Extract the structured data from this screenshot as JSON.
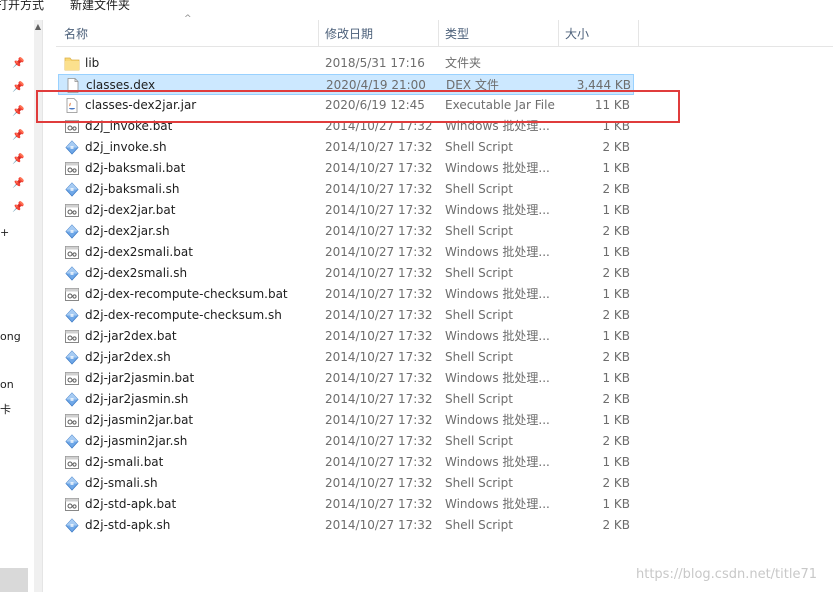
{
  "toolbar": {
    "open_with": "打开方式",
    "new_folder": "新建文件夹"
  },
  "left_pane": {
    "labels": [
      "+",
      "ong",
      "on",
      "卡"
    ]
  },
  "columns": {
    "name": "名称",
    "date": "修改日期",
    "type": "类型",
    "size": "大小"
  },
  "files": [
    {
      "name": "lib",
      "date": "2018/5/31 17:16",
      "type": "文件夹",
      "size": "",
      "icon": "folder-icon"
    },
    {
      "name": "classes.dex",
      "date": "2020/4/19 21:00",
      "type": "DEX 文件",
      "size": "3,444 KB",
      "icon": "file-icon"
    },
    {
      "name": "classes-dex2jar.jar",
      "date": "2020/6/19 12:45",
      "type": "Executable Jar File",
      "size": "11 KB",
      "icon": "jar-icon"
    },
    {
      "name": "d2j_invoke.bat",
      "date": "2014/10/27 17:32",
      "type": "Windows 批处理...",
      "size": "1 KB",
      "icon": "bat-icon"
    },
    {
      "name": "d2j_invoke.sh",
      "date": "2014/10/27 17:32",
      "type": "Shell Script",
      "size": "2 KB",
      "icon": "sh-icon"
    },
    {
      "name": "d2j-baksmali.bat",
      "date": "2014/10/27 17:32",
      "type": "Windows 批处理...",
      "size": "1 KB",
      "icon": "bat-icon"
    },
    {
      "name": "d2j-baksmali.sh",
      "date": "2014/10/27 17:32",
      "type": "Shell Script",
      "size": "2 KB",
      "icon": "sh-icon"
    },
    {
      "name": "d2j-dex2jar.bat",
      "date": "2014/10/27 17:32",
      "type": "Windows 批处理...",
      "size": "1 KB",
      "icon": "bat-icon"
    },
    {
      "name": "d2j-dex2jar.sh",
      "date": "2014/10/27 17:32",
      "type": "Shell Script",
      "size": "2 KB",
      "icon": "sh-icon"
    },
    {
      "name": "d2j-dex2smali.bat",
      "date": "2014/10/27 17:32",
      "type": "Windows 批处理...",
      "size": "1 KB",
      "icon": "bat-icon"
    },
    {
      "name": "d2j-dex2smali.sh",
      "date": "2014/10/27 17:32",
      "type": "Shell Script",
      "size": "2 KB",
      "icon": "sh-icon"
    },
    {
      "name": "d2j-dex-recompute-checksum.bat",
      "date": "2014/10/27 17:32",
      "type": "Windows 批处理...",
      "size": "1 KB",
      "icon": "bat-icon"
    },
    {
      "name": "d2j-dex-recompute-checksum.sh",
      "date": "2014/10/27 17:32",
      "type": "Shell Script",
      "size": "2 KB",
      "icon": "sh-icon"
    },
    {
      "name": "d2j-jar2dex.bat",
      "date": "2014/10/27 17:32",
      "type": "Windows 批处理...",
      "size": "1 KB",
      "icon": "bat-icon"
    },
    {
      "name": "d2j-jar2dex.sh",
      "date": "2014/10/27 17:32",
      "type": "Shell Script",
      "size": "2 KB",
      "icon": "sh-icon"
    },
    {
      "name": "d2j-jar2jasmin.bat",
      "date": "2014/10/27 17:32",
      "type": "Windows 批处理...",
      "size": "1 KB",
      "icon": "bat-icon"
    },
    {
      "name": "d2j-jar2jasmin.sh",
      "date": "2014/10/27 17:32",
      "type": "Shell Script",
      "size": "2 KB",
      "icon": "sh-icon"
    },
    {
      "name": "d2j-jasmin2jar.bat",
      "date": "2014/10/27 17:32",
      "type": "Windows 批处理...",
      "size": "1 KB",
      "icon": "bat-icon"
    },
    {
      "name": "d2j-jasmin2jar.sh",
      "date": "2014/10/27 17:32",
      "type": "Shell Script",
      "size": "2 KB",
      "icon": "sh-icon"
    },
    {
      "name": "d2j-smali.bat",
      "date": "2014/10/27 17:32",
      "type": "Windows 批处理...",
      "size": "1 KB",
      "icon": "bat-icon"
    },
    {
      "name": "d2j-smali.sh",
      "date": "2014/10/27 17:32",
      "type": "Shell Script",
      "size": "2 KB",
      "icon": "sh-icon"
    },
    {
      "name": "d2j-std-apk.bat",
      "date": "2014/10/27 17:32",
      "type": "Windows 批处理...",
      "size": "1 KB",
      "icon": "bat-icon"
    },
    {
      "name": "d2j-std-apk.sh",
      "date": "2014/10/27 17:32",
      "type": "Shell Script",
      "size": "2 KB",
      "icon": "sh-icon"
    }
  ],
  "selected_index": 1,
  "highlighted_index": 2,
  "colors": {
    "selection": "#cce8ff",
    "highlight_border": "#e03c3c",
    "header_text": "#4c607a"
  },
  "watermark": "https://blog.csdn.net/title71"
}
